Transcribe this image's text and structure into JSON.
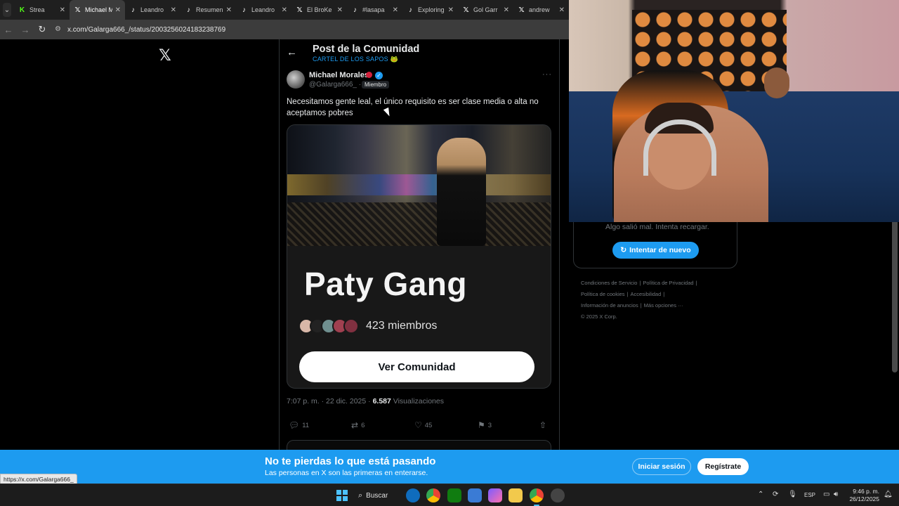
{
  "browser": {
    "tabs": [
      {
        "label": "Strea",
        "favicon": "kick-icon",
        "color": "#53fc18",
        "active": false
      },
      {
        "label": "Michael M",
        "favicon": "x-icon",
        "color": "#ffffff",
        "active": true
      },
      {
        "label": "Leandro",
        "favicon": "tiktok-icon",
        "color": "#ffffff",
        "active": false
      },
      {
        "label": "Resumen",
        "favicon": "tiktok-icon",
        "color": "#ffffff",
        "active": false
      },
      {
        "label": "Leandro",
        "favicon": "tiktok-icon",
        "color": "#ffffff",
        "active": false
      },
      {
        "label": "El BroKe",
        "favicon": "x-icon",
        "color": "#ffffff",
        "active": false
      },
      {
        "label": "#lasapa",
        "favicon": "tiktok-icon",
        "color": "#ffffff",
        "active": false
      },
      {
        "label": "Exploring",
        "favicon": "tiktok-icon",
        "color": "#ffffff",
        "active": false
      },
      {
        "label": "Gol Garr",
        "favicon": "x-icon",
        "color": "#ffffff",
        "active": false
      },
      {
        "label": "andrew",
        "favicon": "x-icon",
        "color": "#ffffff",
        "active": false
      }
    ],
    "url": "x.com/Galarga666_/status/2003256024183238769",
    "status_url": "https://x.com/Galarga666_"
  },
  "post": {
    "header_title": "Post de la Comunidad",
    "community_name": "CARTEL DE LOS SAPOS 🐸",
    "author_name": "Michael Morales",
    "author_handle": "@Galarga666_ ·",
    "member_badge": "Miembro",
    "text": "Necesitamos gente leal, el único requisito es ser clase media o alta no aceptamos pobres",
    "community_card": {
      "name": "Paty Gang",
      "members": "423 miembros",
      "button": "Ver Comunidad"
    },
    "time": "7:07 p. m. · 22 dic. 2025 ·",
    "views_count": "6.587",
    "views_label": "Visualizaciones",
    "replies": "11",
    "reposts": "6",
    "likes": "45",
    "bookmarks": "3"
  },
  "sidebar": {
    "error_text": "Algo salió mal. Intenta recargar.",
    "retry_button": "Intentar de nuevo",
    "footer_links": [
      "Condiciones de Servicio",
      "|",
      "Política de Privacidad",
      "|",
      "Política de cookies",
      "|",
      "Accesibilidad",
      "|",
      "Información de anuncios",
      "|",
      "Más opciones ···",
      "© 2025 X Corp."
    ]
  },
  "banner": {
    "title": "No te pierdas lo que está pasando",
    "subtitle": "Las personas en X son las primeras en enterarse.",
    "login_button": "Iniciar sesión",
    "register_button": "Regístrate"
  },
  "taskbar": {
    "search_label": "Buscar",
    "language": "ESP",
    "time": "9:46 p. m.",
    "date": "26/12/2025"
  },
  "colors": {
    "x_blue": "#1d9bf0",
    "background": "#000000",
    "muted_text": "#71767b"
  }
}
